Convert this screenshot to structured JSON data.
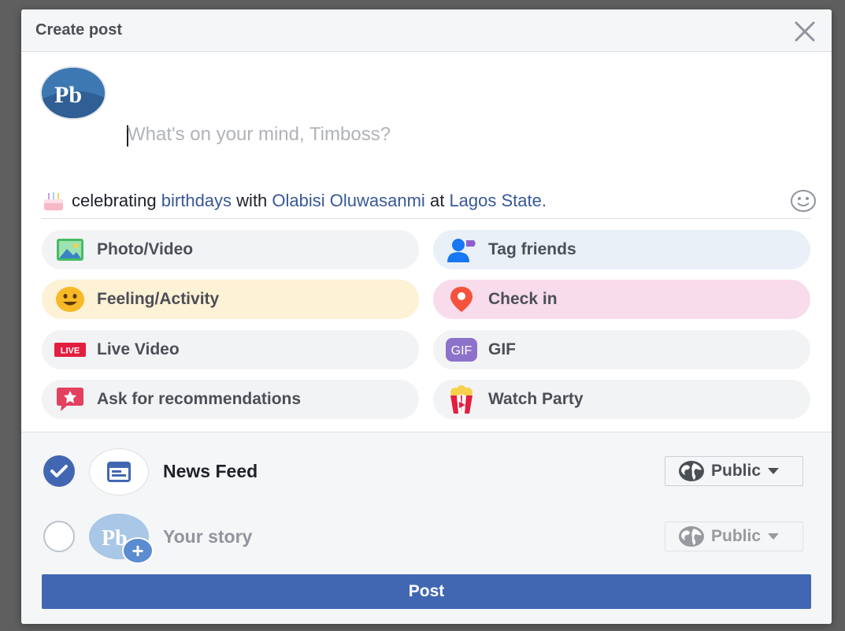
{
  "dialog": {
    "title": "Create post",
    "close_icon": "close-icon"
  },
  "composer": {
    "avatar_initials": "Pb",
    "placeholder": "What's on your mind, Timboss?",
    "value": "",
    "emoji_icon": "smiley-icon"
  },
  "activity": {
    "icon": "birthday-cake-icon",
    "verb": "celebrating",
    "activity_link": "birthdays",
    "with_word": "with",
    "friend": "Olabisi Oluwasanmi",
    "at_word": "at",
    "place": "Lagos State."
  },
  "actions": {
    "photo_video": "Photo/Video",
    "tag_friends": "Tag friends",
    "feeling_activity": "Feeling/Activity",
    "check_in": "Check in",
    "live_video": "Live Video",
    "live_badge": "LIVE",
    "gif": "GIF",
    "ask_recommendations": "Ask for recommendations",
    "watch_party": "Watch Party"
  },
  "destinations": {
    "news_feed": {
      "label": "News Feed",
      "checked": true,
      "privacy": "Public"
    },
    "your_story": {
      "label": "Your story",
      "checked": false,
      "privacy": "Public"
    }
  },
  "post_button": "Post",
  "colors": {
    "brand": "#4267b2",
    "link": "#385898",
    "feeling_bg": "#fdf1d6",
    "checkin_bg": "#f8dcec"
  }
}
